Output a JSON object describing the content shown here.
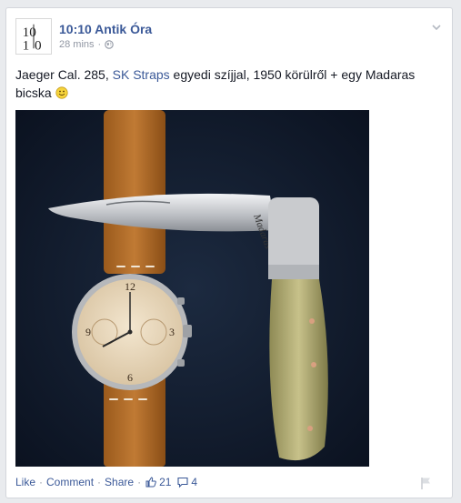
{
  "post": {
    "page_name": "10:10 Antik Óra",
    "timestamp": "28 mins",
    "privacy_icon": "globe-icon",
    "text_before": "Jaeger Cal. 285, ",
    "text_link": "SK Straps",
    "text_after": " egyedi szíjjal, 1950 körülről + egy Madaras bicska ",
    "emoji": "smiley-emoji"
  },
  "avatar": {
    "logo_text": "10 10"
  },
  "photo": {
    "knife_brand": "Madaras"
  },
  "actions": {
    "like": "Like",
    "comment": "Comment",
    "share": "Share",
    "separator": "·",
    "likes_count": "21",
    "comments_count": "4"
  },
  "colors": {
    "link": "#3b5998",
    "muted": "#9197a3",
    "text": "#141823"
  }
}
